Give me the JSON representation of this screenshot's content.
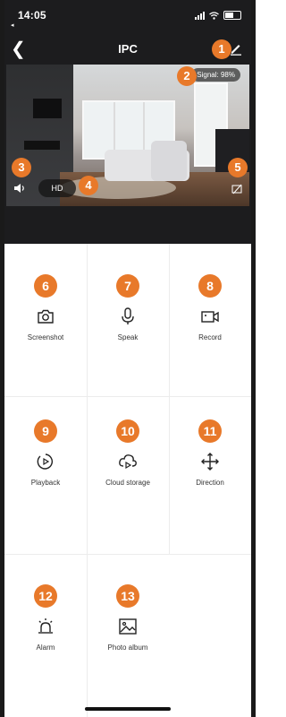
{
  "status_bar": {
    "time": "14:05",
    "back_hint": "◂"
  },
  "nav": {
    "title": "IPC"
  },
  "video": {
    "signal_label": "Signal: 98%",
    "quality_label": "HD"
  },
  "markers": [
    "1",
    "2",
    "3",
    "4",
    "5"
  ],
  "tiles": [
    {
      "num": "6",
      "label": "Screenshot",
      "icon": "camera-icon"
    },
    {
      "num": "7",
      "label": "Speak",
      "icon": "microphone-icon"
    },
    {
      "num": "8",
      "label": "Record",
      "icon": "video-record-icon"
    },
    {
      "num": "9",
      "label": "Playback",
      "icon": "playback-icon"
    },
    {
      "num": "10",
      "label": "Cloud storage",
      "icon": "cloud-play-icon"
    },
    {
      "num": "11",
      "label": "Direction",
      "icon": "move-arrows-icon"
    },
    {
      "num": "12",
      "label": "Alarm",
      "icon": "alarm-light-icon"
    },
    {
      "num": "13",
      "label": "Photo album",
      "icon": "image-icon"
    }
  ],
  "colors": {
    "accent": "#e8792a",
    "header_bg": "#1c1c1e"
  }
}
